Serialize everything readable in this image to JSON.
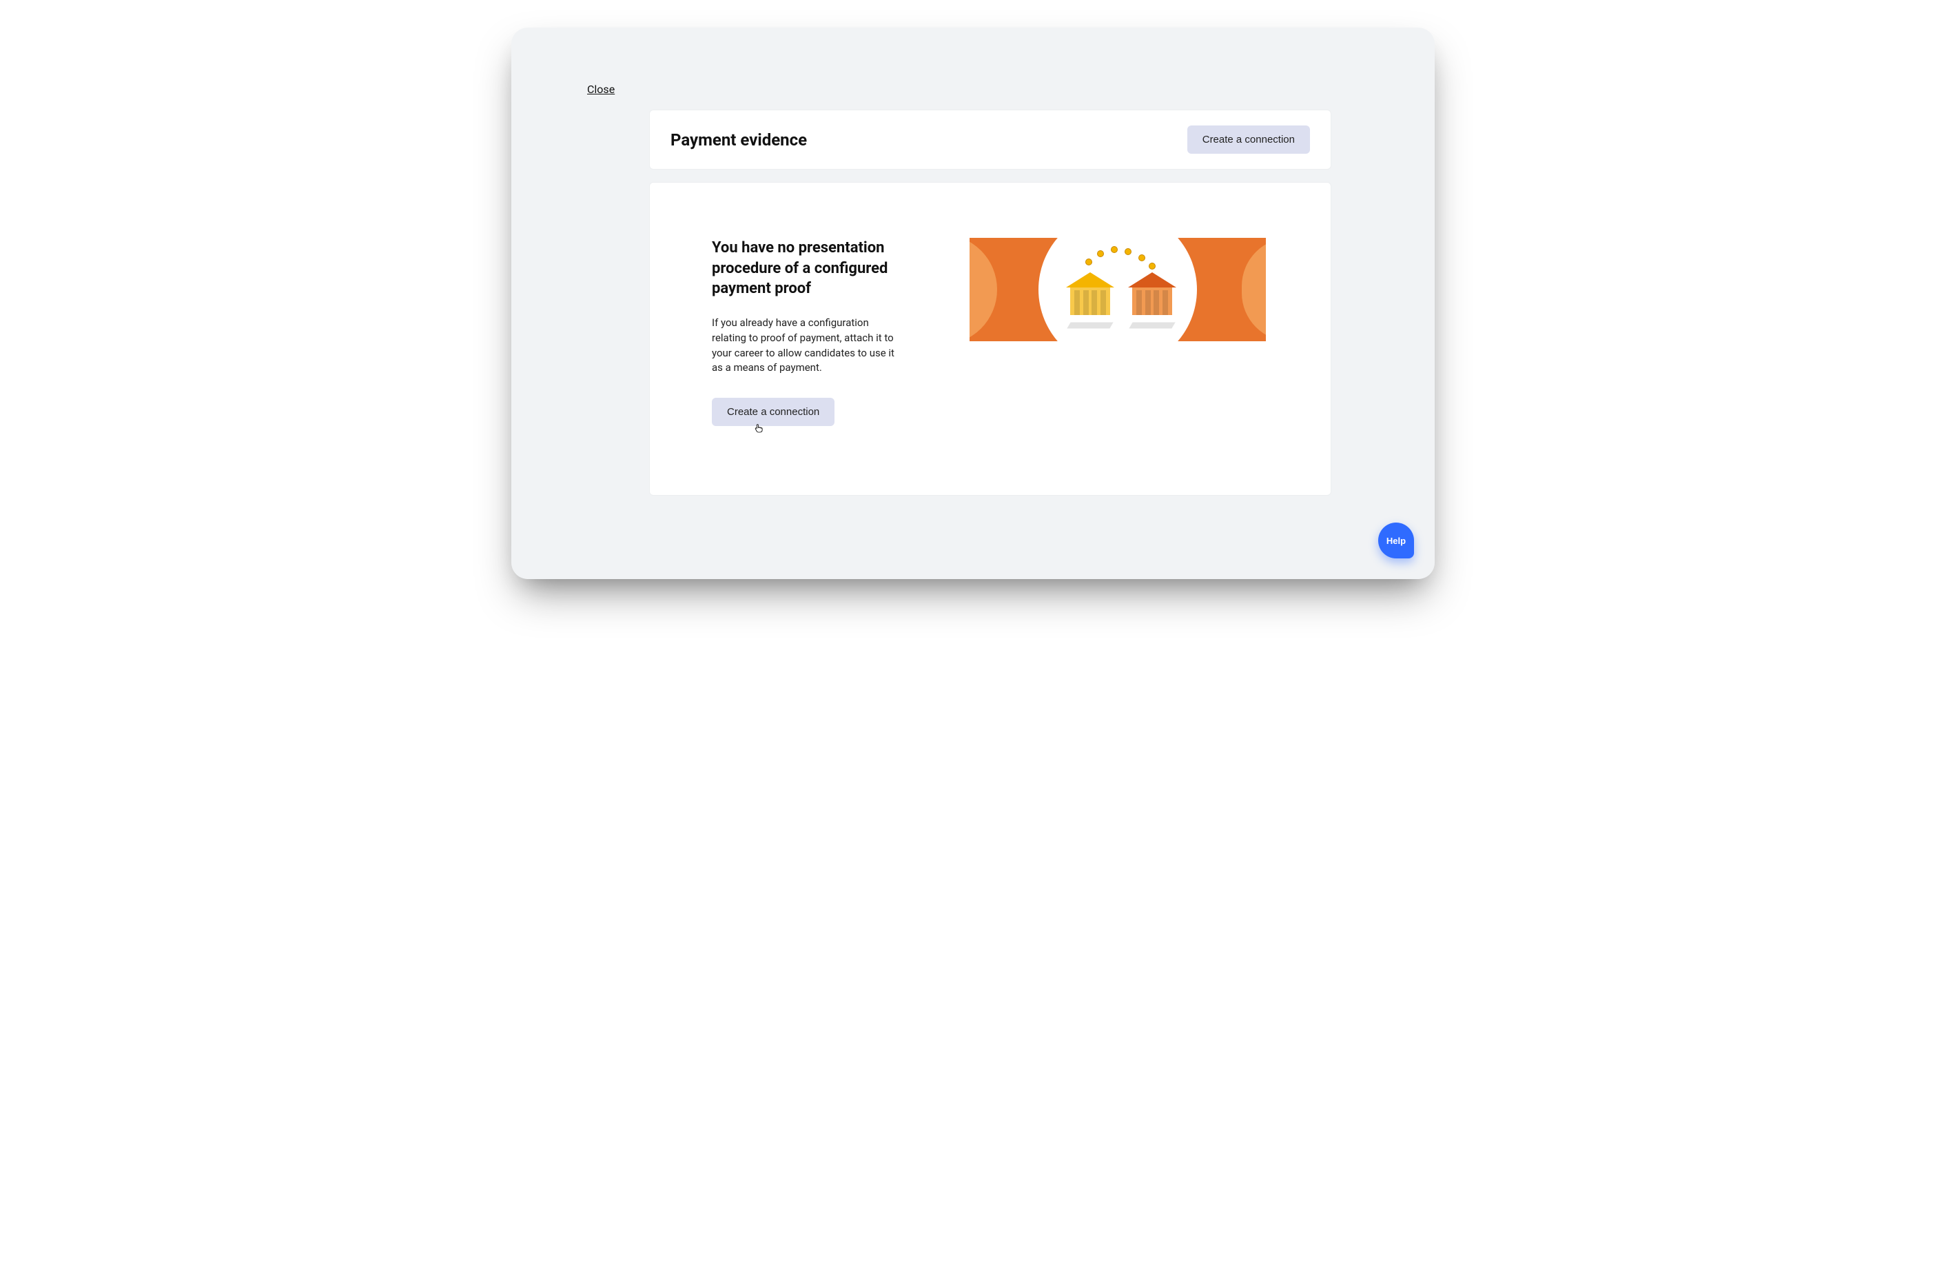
{
  "close_label": "Close",
  "header": {
    "title": "Payment evidence",
    "create_button_label": "Create a connection"
  },
  "empty_state": {
    "title": "You have no presentation procedure of a configured payment proof",
    "description": "If you already have a configuration relating to proof of payment, attach it to your career to allow candidates to use it as a means of payment.",
    "create_button_label": "Create a connection"
  },
  "help_label": "Help",
  "colors": {
    "page_bg": "#f1f3f5",
    "button_bg": "#dcdff0",
    "illustration_bg": "#e8742c",
    "help_bg": "#2f6bff"
  }
}
